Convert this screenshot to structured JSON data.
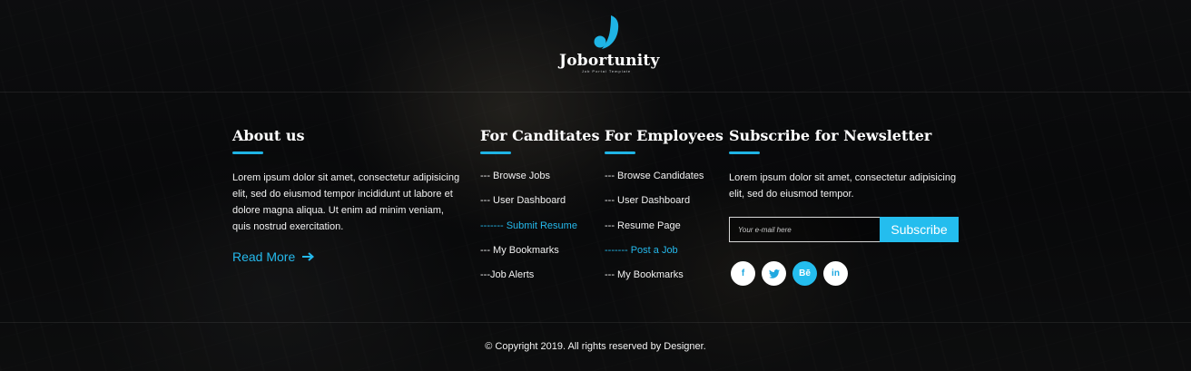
{
  "brand": {
    "name": "Jobortunity",
    "tagline": "Job Portal Template",
    "accent_color": "#1fb4e5"
  },
  "about": {
    "heading": "About us",
    "text": "Lorem ipsum dolor sit amet, consectetur adipisicing elit, sed do eiusmod tempor incididunt ut labore et dolore magna aliqua. Ut enim ad minim veniam, quis nostrud exercitation.",
    "read_more": "Read More",
    "read_more_icon": "arrow-right-icon"
  },
  "candidates": {
    "heading": "For Canditates",
    "links": [
      {
        "label": "--- Browse Jobs",
        "active": false
      },
      {
        "label": "--- User Dashboard",
        "active": false
      },
      {
        "label": "------- Submit Resume",
        "active": true
      },
      {
        "label": "--- My Bookmarks",
        "active": false
      },
      {
        "label": "---Job Alerts",
        "active": false
      }
    ]
  },
  "employees": {
    "heading": "For Employees",
    "links": [
      {
        "label": "--- Browse Candidates",
        "active": false
      },
      {
        "label": "--- User Dashboard",
        "active": false
      },
      {
        "label": "--- Resume Page",
        "active": false
      },
      {
        "label": "------- Post a Job",
        "active": true
      },
      {
        "label": "--- My Bookmarks",
        "active": false
      }
    ]
  },
  "newsletter": {
    "heading": "Subscribe for Newsletter",
    "text": "Lorem ipsum dolor sit amet, consectetur adipisicing elit, sed do eiusmod tempor.",
    "placeholder": "Your e-mail here",
    "button": "Subscribe",
    "socials": [
      {
        "icon": "facebook-icon",
        "glyph": "f",
        "active": false
      },
      {
        "icon": "twitter-icon",
        "glyph": "🐦",
        "active": false
      },
      {
        "icon": "behance-icon",
        "glyph": "Bē",
        "active": true
      },
      {
        "icon": "linkedin-icon",
        "glyph": "in",
        "active": false
      }
    ]
  },
  "footer": {
    "copyright": "© Copyright 2019. All rights reserved by Designer."
  }
}
